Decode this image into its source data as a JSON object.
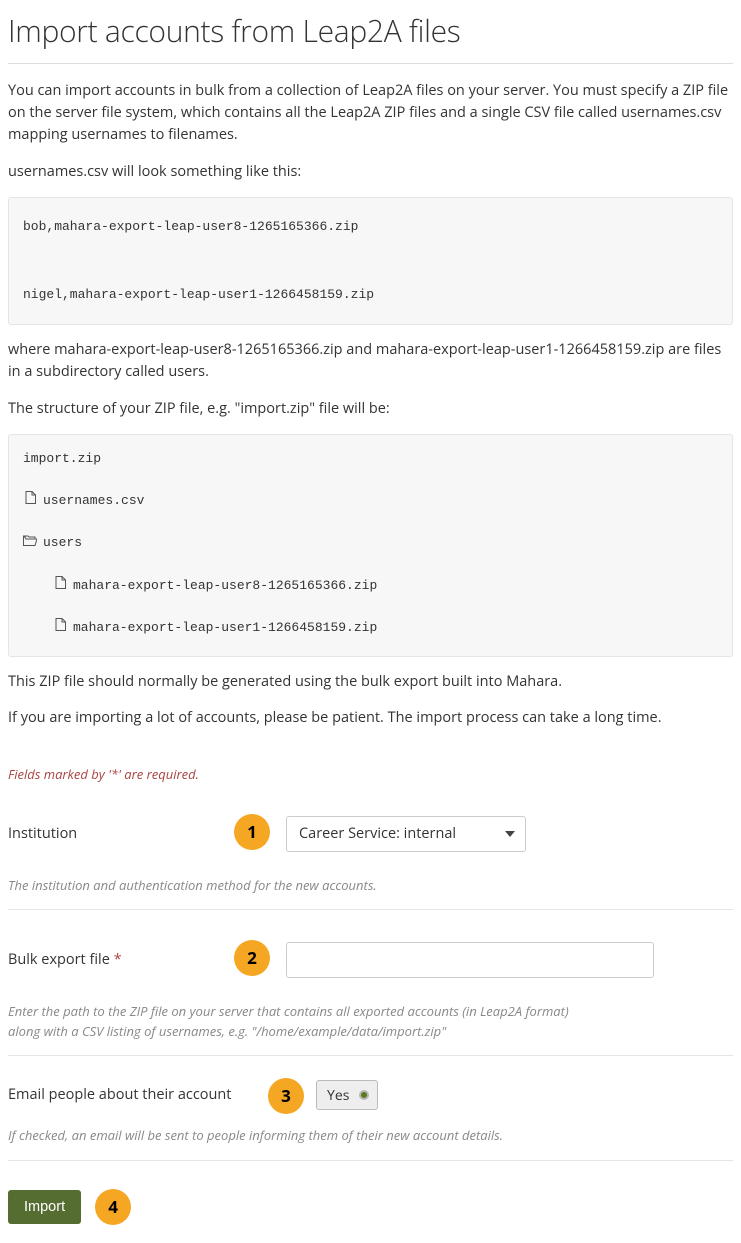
{
  "title": "Import accounts from Leap2A files",
  "intro": "You can import accounts in bulk from a collection of Leap2A files on your server. You must specify a ZIP file on the server file system, which contains all the Leap2A ZIP files and a single CSV file called usernames.csv mapping usernames to filenames.",
  "csvLead": "usernames.csv will look something like this:",
  "csvExample": "bob,mahara-export-leap-user8-1265165366.zip\n\nnigel,mahara-export-leap-user1-1266458159.zip",
  "csvFollow": "where mahara-export-leap-user8-1265165366.zip and mahara-export-leap-user1-1266458159.zip are files in a subdirectory called users.",
  "zipLead": "The structure of your ZIP file, e.g. \"import.zip\" file will be:",
  "tree": {
    "root": "import.zip",
    "csv": "usernames.csv",
    "dir": "users",
    "file1": "mahara-export-leap-user8-1265165366.zip",
    "file2": "mahara-export-leap-user1-1266458159.zip"
  },
  "zipNote": "This ZIP file should normally be generated using the bulk export built into Mahara.",
  "patienceNote": "If you are importing a lot of accounts, please be patient. The import process can take a long time.",
  "requiredNote": "Fields marked by '*' are required.",
  "form": {
    "institution": {
      "label": "Institution",
      "badge": "1",
      "selected": "Career Service: internal",
      "help": "The institution and authentication method for the new accounts."
    },
    "file": {
      "label": "Bulk export file",
      "required": "*",
      "badge": "2",
      "value": "",
      "help": "Enter the path to the ZIP file on your server that contains all exported accounts (in Leap2A format) along with a CSV listing of usernames, e.g. \"/home/example/data/import.zip\""
    },
    "email": {
      "label": "Email people about their account",
      "badge": "3",
      "toggle": "Yes",
      "help": "If checked, an email will be sent to people informing them of their new account details."
    },
    "submit": {
      "label": "Import",
      "badge": "4"
    }
  }
}
